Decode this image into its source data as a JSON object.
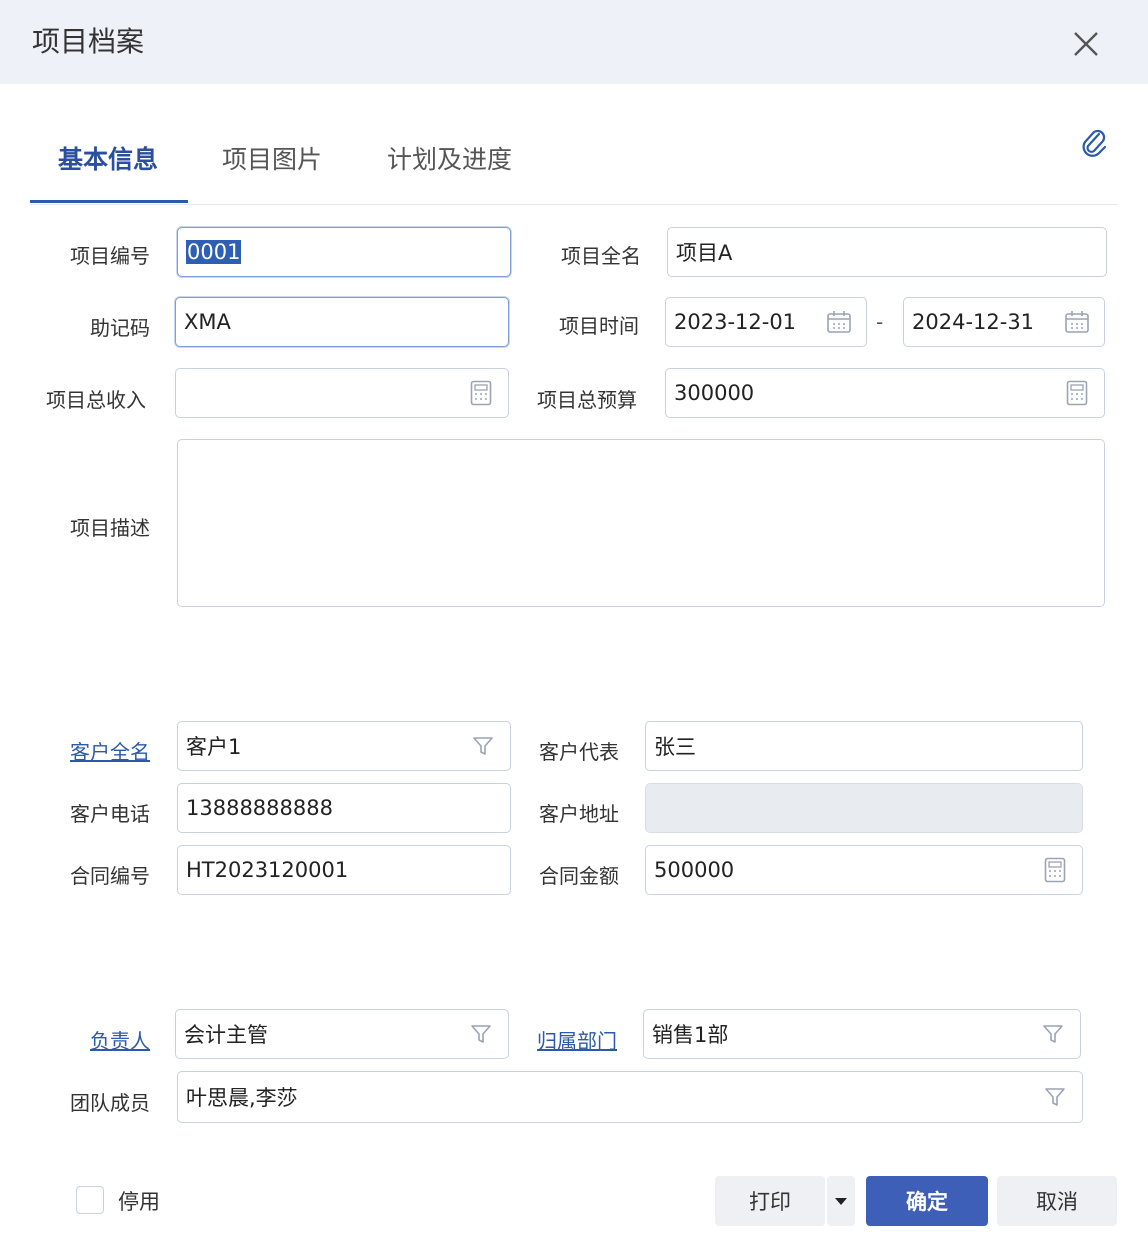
{
  "dialog": {
    "title": "项目档案"
  },
  "tabs": [
    {
      "label": "基本信息",
      "active": true
    },
    {
      "label": "项目图片",
      "active": false
    },
    {
      "label": "计划及进度",
      "active": false
    }
  ],
  "project": {
    "code_label": "项目编号",
    "code_value": "0001",
    "fullname_label": "项目全名",
    "fullname_value": "项目A",
    "mnemonic_label": "助记码",
    "mnemonic_value": "XMA",
    "period_label": "项目时间",
    "start_date": "2023-12-01",
    "separator": "-",
    "end_date": "2024-12-31",
    "income_label": "项目总收入",
    "income_value": "",
    "budget_label": "项目总预算",
    "budget_value": "300000",
    "desc_label": "项目描述",
    "desc_value": ""
  },
  "customer": {
    "name_label": "客户全名",
    "name_value": "客户1",
    "rep_label": "客户代表",
    "rep_value": "张三",
    "phone_label": "客户电话",
    "phone_value": "13888888888",
    "address_label": "客户地址",
    "address_value": "",
    "contract_no_label": "合同编号",
    "contract_no_value": "HT2023120001",
    "contract_amount_label": "合同金额",
    "contract_amount_value": "500000"
  },
  "team": {
    "owner_label": "负责人",
    "owner_value": "会计主管",
    "dept_label": "归属部门",
    "dept_value": "销售1部",
    "members_label": "团队成员",
    "members_value": "叶思晨,李莎"
  },
  "footer": {
    "disable_label": "停用",
    "print_label": "打印",
    "ok_label": "确定",
    "cancel_label": "取消"
  },
  "colors": {
    "accent": "#2b5aa8",
    "primary_button": "#3d5fb8",
    "header_bg": "#eef1f7"
  }
}
